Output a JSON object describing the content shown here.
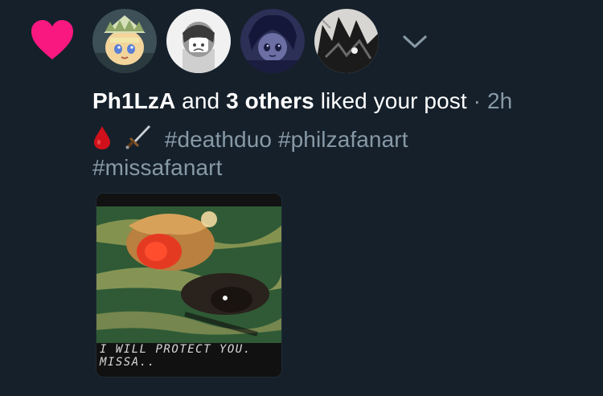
{
  "notification": {
    "liker_name": "Ph1LzA",
    "joiner": "and",
    "others": "3 others",
    "action": "liked your post",
    "separator": "·",
    "time": "2h",
    "emoji_1": "blood-drop",
    "emoji_2": "dagger",
    "hashtags": [
      "#deathduo",
      "#philzafanart",
      "#missafanart"
    ],
    "image_caption": "I WILL PROTECT YOU. MISSA.."
  },
  "avatars": [
    "avatar-1",
    "avatar-2",
    "avatar-3",
    "avatar-4"
  ],
  "colors": {
    "background": "#15202b",
    "heart": "#f91880",
    "muted_text": "#8899a6",
    "primary_text": "#ffffff"
  }
}
